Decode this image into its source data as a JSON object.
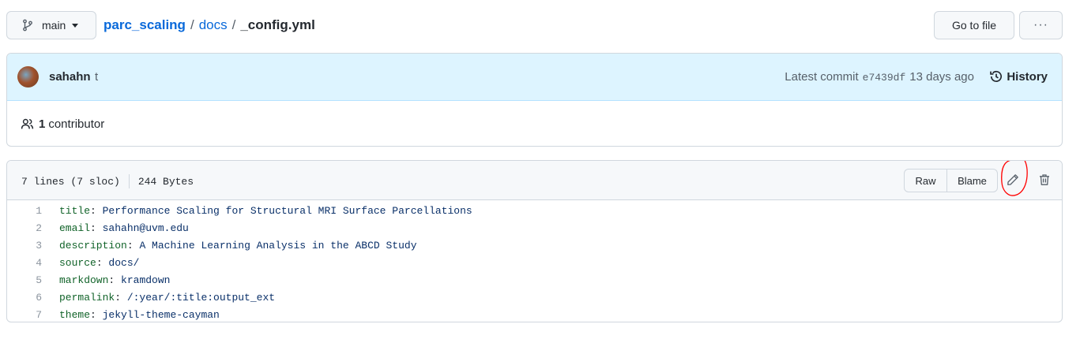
{
  "topbar": {
    "branch": "main",
    "repo": "parc_scaling",
    "separator": "/",
    "dir": "docs",
    "file": "_config.yml",
    "goto_label": "Go to file",
    "more_label": "···"
  },
  "commit": {
    "author": "sahahn",
    "message": "t",
    "latest_label": "Latest commit",
    "sha": "e7439df",
    "age": "13 days ago",
    "history_label": "History"
  },
  "contributors": {
    "count": "1",
    "label": "contributor"
  },
  "file": {
    "lines_info": "7 lines (7 sloc)",
    "size": "244 Bytes",
    "raw_label": "Raw",
    "blame_label": "Blame",
    "lines": [
      {
        "n": "1",
        "key": "title",
        "colon": ":",
        "value": " Performance Scaling for Structural MRI Surface Parcellations"
      },
      {
        "n": "2",
        "key": "email",
        "colon": ":",
        "value": " sahahn@uvm.edu"
      },
      {
        "n": "3",
        "key": "description",
        "colon": ":",
        "value": " A Machine Learning Analysis in the ABCD Study"
      },
      {
        "n": "4",
        "key": "source",
        "colon": ":",
        "value": " docs/"
      },
      {
        "n": "5",
        "key": "markdown",
        "colon": ":",
        "value": " kramdown"
      },
      {
        "n": "6",
        "key": "permalink",
        "colon": ":",
        "value": " /:year/:title:output_ext"
      },
      {
        "n": "7",
        "key": "theme",
        "colon": ":",
        "value": " jekyll-theme-cayman"
      }
    ]
  },
  "colors": {
    "link": "#0969da",
    "key": "#116329",
    "value": "#0a3069",
    "annotation": "#ff0000"
  },
  "icons": [
    "git-branch-icon",
    "history-icon",
    "people-icon",
    "pencil-icon",
    "trash-icon",
    "kebab-icon"
  ]
}
